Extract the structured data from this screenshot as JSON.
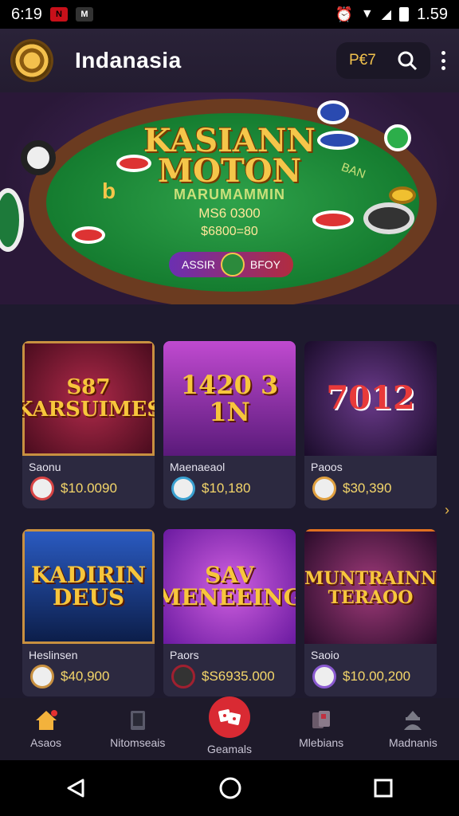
{
  "status_bar": {
    "time": "6:19",
    "battery": "1.59"
  },
  "header": {
    "app_title": "Indanasia",
    "pill_label": "P€7"
  },
  "hero": {
    "title_line1": "KASIANN",
    "title_line2": "MOTON",
    "subtitle": "MARUMAMMIN",
    "amount1": "MS6 0300",
    "amount2": "$6800=80",
    "button_left": "ASSIR",
    "button_right": "BFOY",
    "side_left": "b",
    "side_right": "BAN"
  },
  "games": [
    {
      "thumb": "S87 KARSUIMES",
      "name": "Saonu",
      "price": "$10.0090",
      "color": "#7a1a2e"
    },
    {
      "thumb": "1420 3 1N",
      "name": "Maenaeaol",
      "price": "$10,180",
      "color": "#8a2aa0"
    },
    {
      "thumb": "7012",
      "name": "Paoos",
      "price": "$30,390",
      "color": "#3a1f4a"
    },
    {
      "thumb": "KADIRIN DEUS",
      "name": "Heslinsen",
      "price": "$40,900",
      "color": "#1e4aa0"
    },
    {
      "thumb": "SAV MENEEING",
      "name": "Paors",
      "price": "$S6935.000",
      "color": "#7a2ac0"
    },
    {
      "thumb": "MUNTRAINN TERAOO",
      "name": "Saoio",
      "price": "$10.00,200",
      "color": "#4a1a44"
    }
  ],
  "nav": [
    {
      "label": "Asaos",
      "icon": "home-icon"
    },
    {
      "label": "Nitomseais",
      "icon": "tablet-icon"
    },
    {
      "label": "Geamals",
      "icon": "dice-icon"
    },
    {
      "label": "Mlebians",
      "icon": "cards-icon"
    },
    {
      "label": "Madnanis",
      "icon": "person-icon"
    }
  ]
}
